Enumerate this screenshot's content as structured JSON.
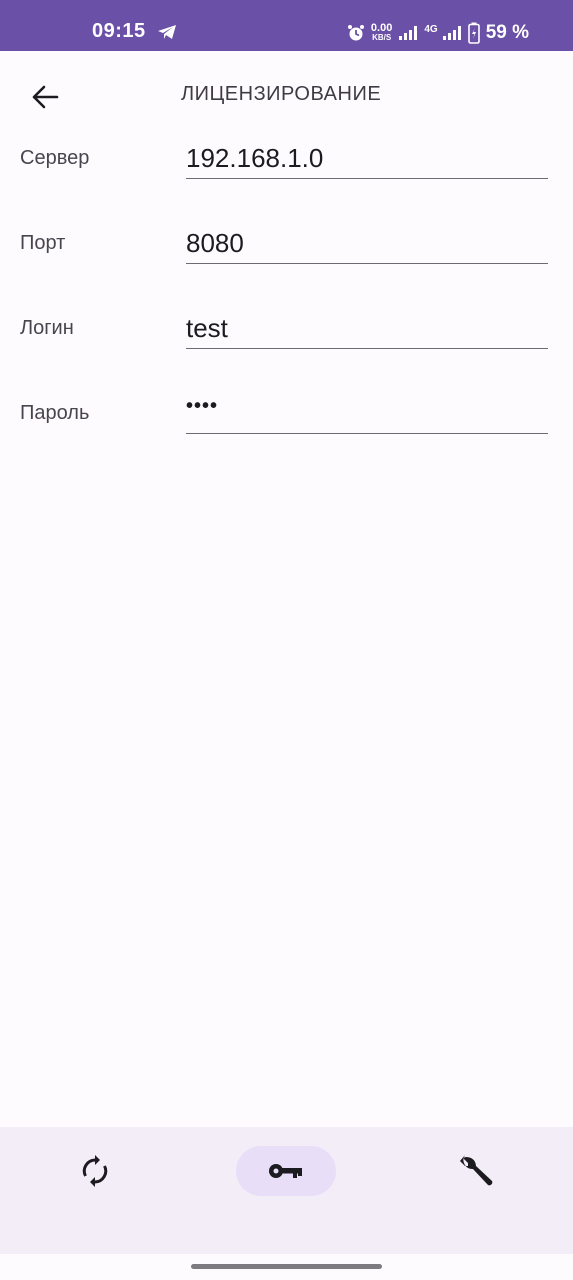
{
  "status_bar": {
    "time": "09:15",
    "net_speed_value": "0.00",
    "net_speed_unit": "KB/S",
    "network_type": "4G",
    "battery": "59 %",
    "background_color": "#6a50a6"
  },
  "app_bar": {
    "title": "ЛИЦЕНЗИРОВАНИЕ",
    "back_icon": "arrow-back-icon"
  },
  "form": {
    "server": {
      "label": "Сервер",
      "value": "192.168.1.0"
    },
    "port": {
      "label": "Порт",
      "value": "8080"
    },
    "login": {
      "label": "Логин",
      "value": "test"
    },
    "password": {
      "label": "Пароль",
      "masked_value": "••••"
    }
  },
  "bottom_nav": {
    "items": [
      {
        "icon": "sync-icon",
        "active": false
      },
      {
        "icon": "key-icon",
        "active": true
      },
      {
        "icon": "wrench-icon",
        "active": false
      }
    ],
    "active_color": "#e8def8",
    "background_color": "#f3edf7"
  }
}
